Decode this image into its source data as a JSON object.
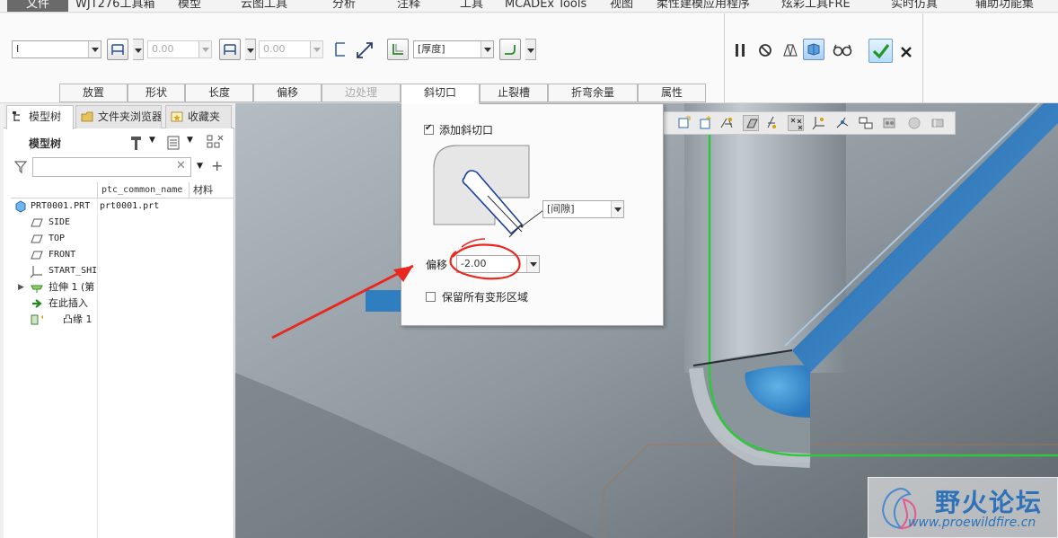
{
  "menubar": {
    "items": [
      "文件",
      "WJT276工具箱",
      "模型",
      "云图工具",
      "分析",
      "注释",
      "工具",
      "MCADEx Tools",
      "视图",
      "柔性建模应用程序",
      "炫彩工具FRE",
      "实时仿真",
      "辅助功能集"
    ]
  },
  "dashboard": {
    "type_select": "I",
    "value1": "0.00",
    "value2": "0.00",
    "thickness_select": "[厚度]",
    "tabs": [
      "放置",
      "形状",
      "长度",
      "偏移",
      "边处理",
      "斜切口",
      "止裂槽",
      "折弯余量",
      "属性"
    ],
    "active_tab": "斜切口",
    "disabled_tab": "边处理"
  },
  "left_panel": {
    "tabs": [
      "模型树",
      "文件夹浏览器",
      "收藏夹"
    ],
    "tree_title": "模型树",
    "filter_placeholder": "",
    "columns": [
      "ptc_common_name",
      "材料"
    ],
    "rows": [
      {
        "label": "PRT0001.PRT",
        "common_name": "prt0001.prt",
        "icon": "part-icon"
      },
      {
        "label": "SIDE",
        "icon": "datum-plane-icon"
      },
      {
        "label": "TOP",
        "icon": "datum-plane-icon"
      },
      {
        "label": "FRONT",
        "icon": "datum-plane-icon"
      },
      {
        "label": "START_SHI",
        "icon": "csys-icon"
      },
      {
        "label": "拉伸 1 (第",
        "icon": "extrude-icon"
      },
      {
        "label": "在此插入",
        "icon": "insert-arrow-icon"
      },
      {
        "label": "凸缘 1",
        "icon": "flange-icon"
      }
    ]
  },
  "bevel_panel": {
    "add_miter_label": "添加斜切口",
    "add_miter_checked": true,
    "gap_select": "[间隙]",
    "offset_label": "偏移",
    "offset_value": "-2.00",
    "keep_all_label": "保留所有变形区域",
    "keep_all_checked": false
  },
  "watermark": {
    "title": "野火论坛",
    "url": "www.proewildfire.cn"
  },
  "colors": {
    "accent_blue": "#2f72b8",
    "annotation_red": "#e8281e",
    "sweep_green": "#2fc83a"
  }
}
